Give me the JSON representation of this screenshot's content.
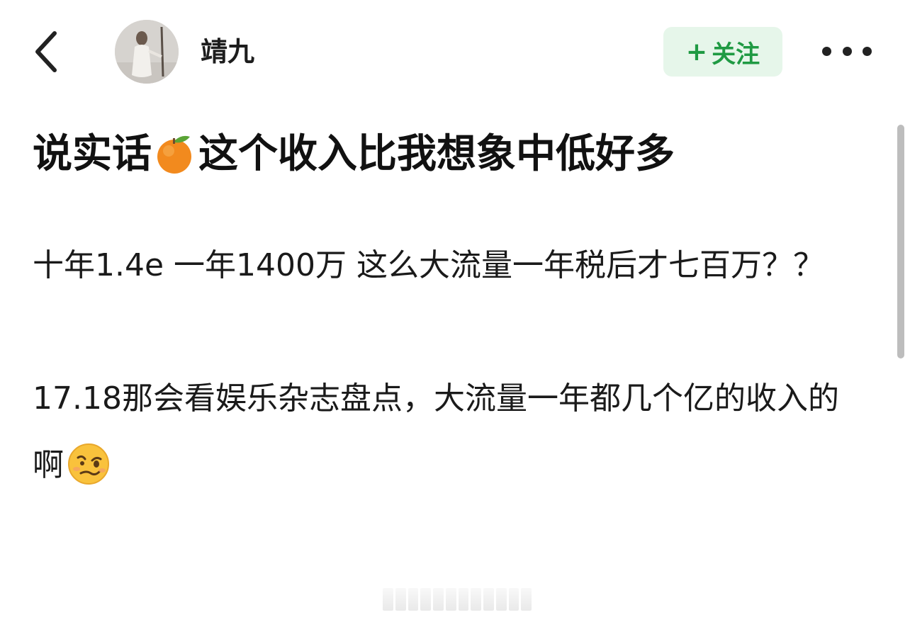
{
  "header": {
    "back_icon": "chevron-left-icon",
    "username": "靖九",
    "follow_label": "关注",
    "follow_plus": "+",
    "follow_color": "#1f9a43",
    "more_icon": "more-horizontal-icon"
  },
  "post": {
    "title_before": "说实话",
    "title_emoji": "tangerine-icon",
    "title_after": "这个收入比我想象中低好多",
    "paragraph1": "十年1.4e 一年1400万 这么大流量一年税后才七百万？？",
    "paragraph2": "17.18那会看娱乐杂志盘点，大流量一年都几个亿的收入的啊",
    "paragraph2_emoji": "woozy-face-icon"
  }
}
